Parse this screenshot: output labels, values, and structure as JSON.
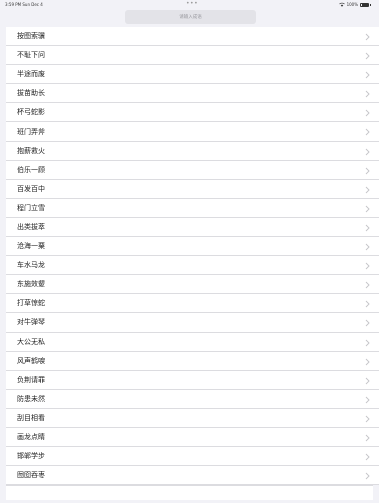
{
  "status_bar": {
    "time_date": "3:59 PM  Sun Dec 4",
    "center_dots": "•••",
    "battery_text": "100%",
    "battery_level": 1.0
  },
  "search": {
    "placeholder": "请输入成语"
  },
  "list": {
    "items": [
      {
        "label": "按图索骥"
      },
      {
        "label": "不耻下问"
      },
      {
        "label": "半途而废"
      },
      {
        "label": "拔苗助长"
      },
      {
        "label": "杯弓蛇影"
      },
      {
        "label": "班门弄斧"
      },
      {
        "label": "抱薪救火"
      },
      {
        "label": "伯乐一顾"
      },
      {
        "label": "百发百中"
      },
      {
        "label": "程门立雪"
      },
      {
        "label": "出类拔萃"
      },
      {
        "label": "沧海一粟"
      },
      {
        "label": "车水马龙"
      },
      {
        "label": "东施效颦"
      },
      {
        "label": "打草惊蛇"
      },
      {
        "label": "对牛弹琴"
      },
      {
        "label": "大公无私"
      },
      {
        "label": "风声鹤唳"
      },
      {
        "label": "负荆请罪"
      },
      {
        "label": "防患未然"
      },
      {
        "label": "刮目相看"
      },
      {
        "label": "画龙点睛"
      },
      {
        "label": "邯郸学步"
      },
      {
        "label": "囫囵吞枣"
      }
    ]
  },
  "icons": {
    "row_disclosure": "chevron-right-icon",
    "wifi": "wifi-icon",
    "battery": "battery-icon"
  }
}
